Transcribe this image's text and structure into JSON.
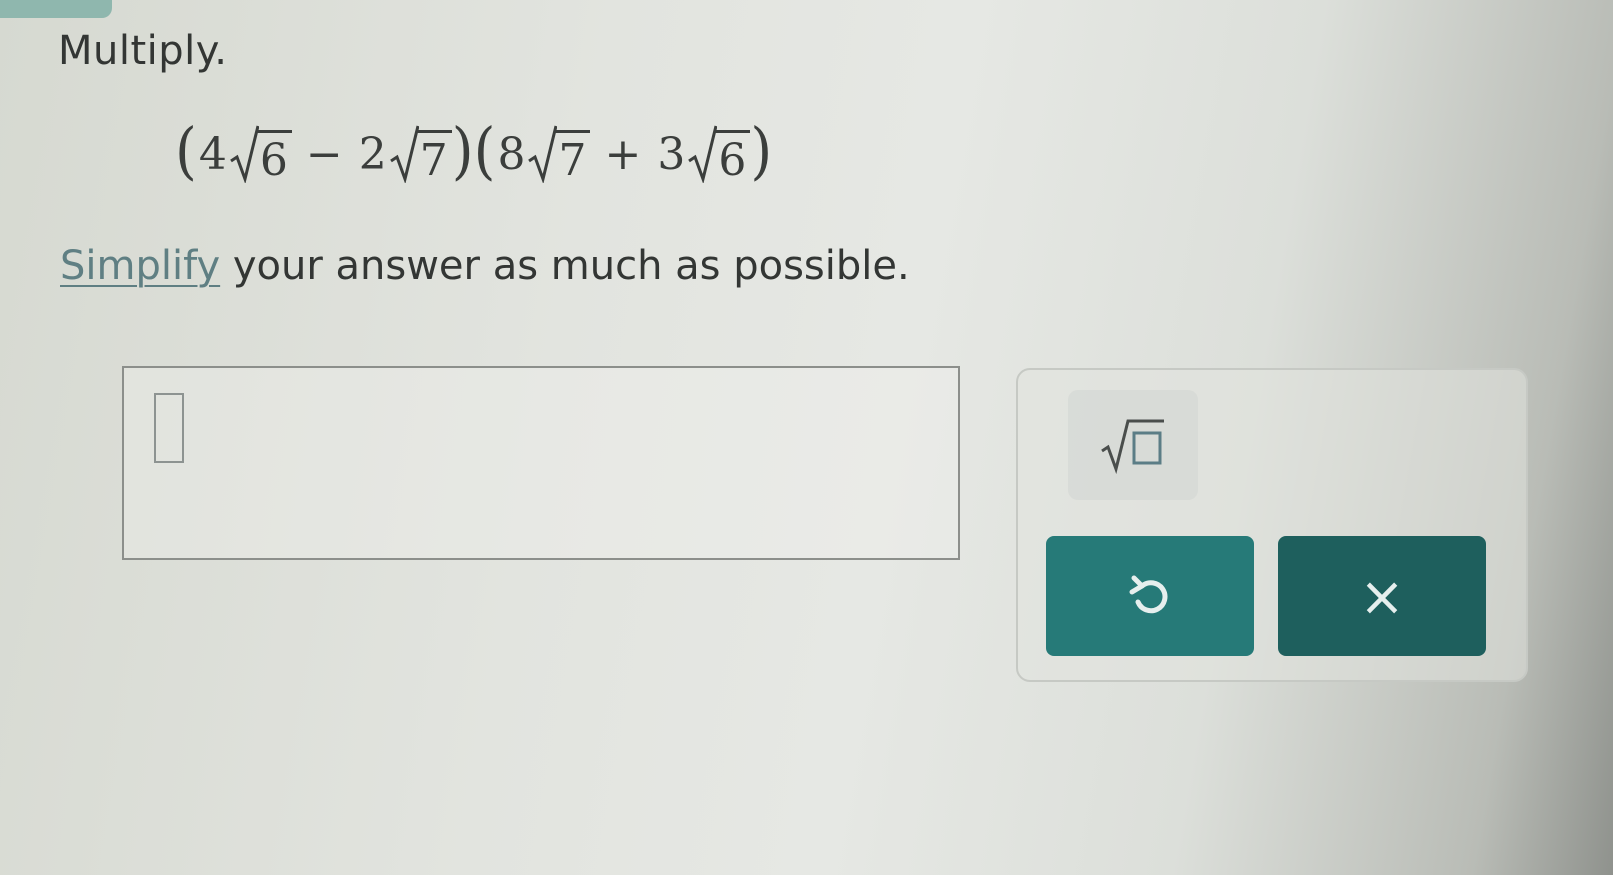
{
  "prompt": {
    "instruction": "Multiply."
  },
  "expression": {
    "open_paren": "(",
    "close_paren": ")",
    "term1": {
      "coefficient": "4",
      "radicand": "6"
    },
    "op1": "−",
    "term2": {
      "coefficient": "2",
      "radicand": "7"
    },
    "term3": {
      "coefficient": "8",
      "radicand": "7"
    },
    "op2": "+",
    "term4": {
      "coefficient": "3",
      "radicand": "6"
    }
  },
  "simplify_note": {
    "link_text": "Simplify",
    "rest_text": " your answer as much as possible."
  },
  "answer": {
    "value": ""
  },
  "tools": {
    "square_root_icon": "square-root-template-icon",
    "undo_icon": "undo-icon",
    "clear_label": "×",
    "accent_color": "#267a78",
    "dark_accent_color": "#1e5f5d"
  }
}
